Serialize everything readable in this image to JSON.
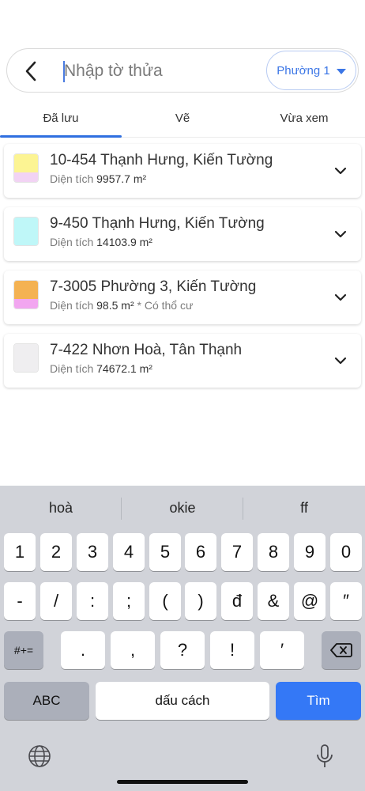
{
  "search": {
    "placeholder": "Nhập tờ thửa",
    "ward": "Phường 1"
  },
  "tabs": [
    {
      "label": "Đã lưu",
      "active": true
    },
    {
      "label": "Vẽ",
      "active": false
    },
    {
      "label": "Vừa xem",
      "active": false
    }
  ],
  "parcels": [
    {
      "title": "10-454 Thạnh Hưng, Kiến Tường",
      "area_label": "Diện tích",
      "area": "9957.7 m²",
      "note": "",
      "color_top": "#fcf493",
      "color_bottom": "#f2d3f4"
    },
    {
      "title": "9-450 Thạnh Hưng, Kiến Tường",
      "area_label": "Diện tích",
      "area": "14103.9 m²",
      "note": "",
      "color_top": "#bff7f8",
      "color_bottom": "#bff7f8"
    },
    {
      "title": "7-3005 Phường 3, Kiến Tường",
      "area_label": "Diện tích",
      "area": "98.5 m²",
      "note": "* Có thổ cư",
      "color_top": "#f4b252",
      "color_bottom": "#f2a6f0"
    },
    {
      "title": "7-422 Nhơn Hoà, Tân Thạnh",
      "area_label": "Diện tích",
      "area": "74672.1 m²",
      "note": "",
      "color_top": "#efeef0",
      "color_bottom": "#efeef0"
    }
  ],
  "keyboard": {
    "suggestions": [
      "hoà",
      "okie",
      "ff"
    ],
    "row1": [
      "1",
      "2",
      "3",
      "4",
      "5",
      "6",
      "7",
      "8",
      "9",
      "0"
    ],
    "row2": [
      "-",
      "/",
      ":",
      ";",
      "(",
      ")",
      "đ",
      "&",
      "@",
      "″"
    ],
    "row3": [
      ".",
      ",",
      "?",
      "!",
      "′"
    ],
    "symbols_key": "#+=",
    "abc_key": "ABC",
    "space_key": "dấu cách",
    "return_key": "Tìm"
  },
  "colors": {
    "accent": "#3478f6",
    "tab_indicator": "#2f6fe0",
    "keyboard_bg": "#d1d3d9"
  }
}
